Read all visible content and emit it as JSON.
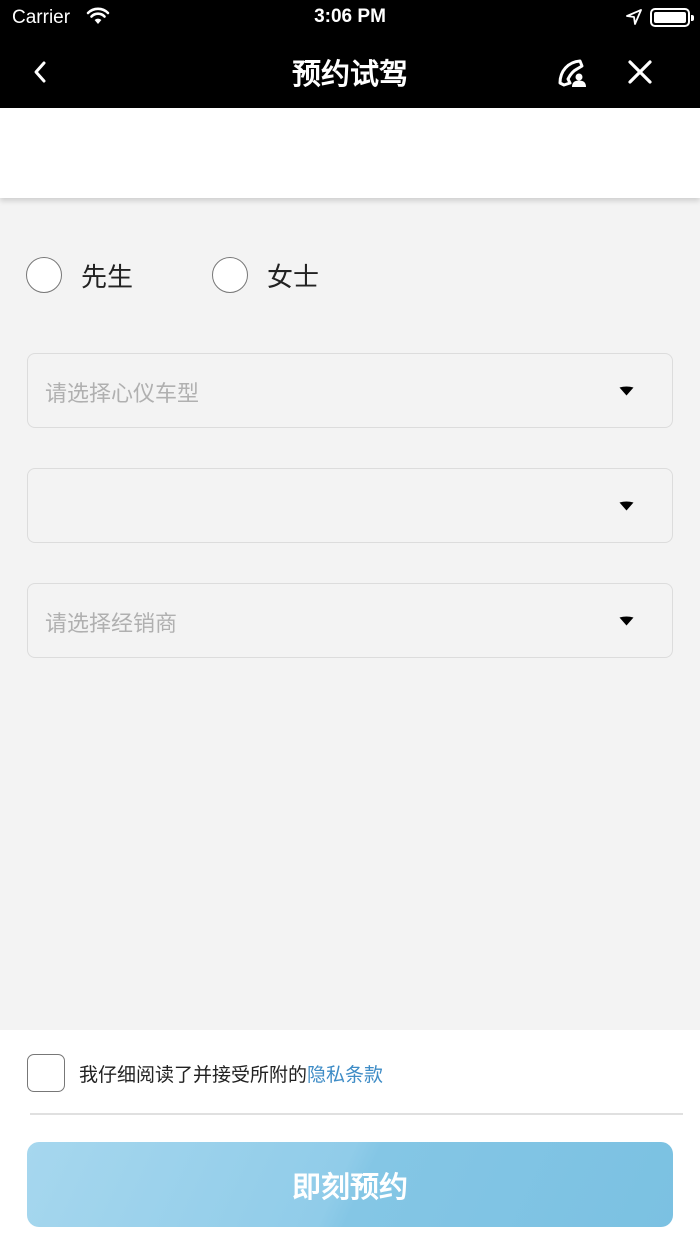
{
  "status_bar": {
    "carrier": "Carrier",
    "time": "3:06 PM"
  },
  "nav": {
    "title": "预约试驾"
  },
  "gender": {
    "mr": "先生",
    "ms": "女士"
  },
  "form": {
    "model_placeholder": "请选择心仪车型",
    "city_placeholder": "",
    "dealer_placeholder": "请选择经销商"
  },
  "footer": {
    "agree_text": "我仔细阅读了并接受所附的",
    "privacy_link": "隐私条款",
    "submit_label": "即刻预约"
  },
  "colors": {
    "accent": "#3e8cc6",
    "submit": "#84c6e5",
    "header": "#000000"
  }
}
